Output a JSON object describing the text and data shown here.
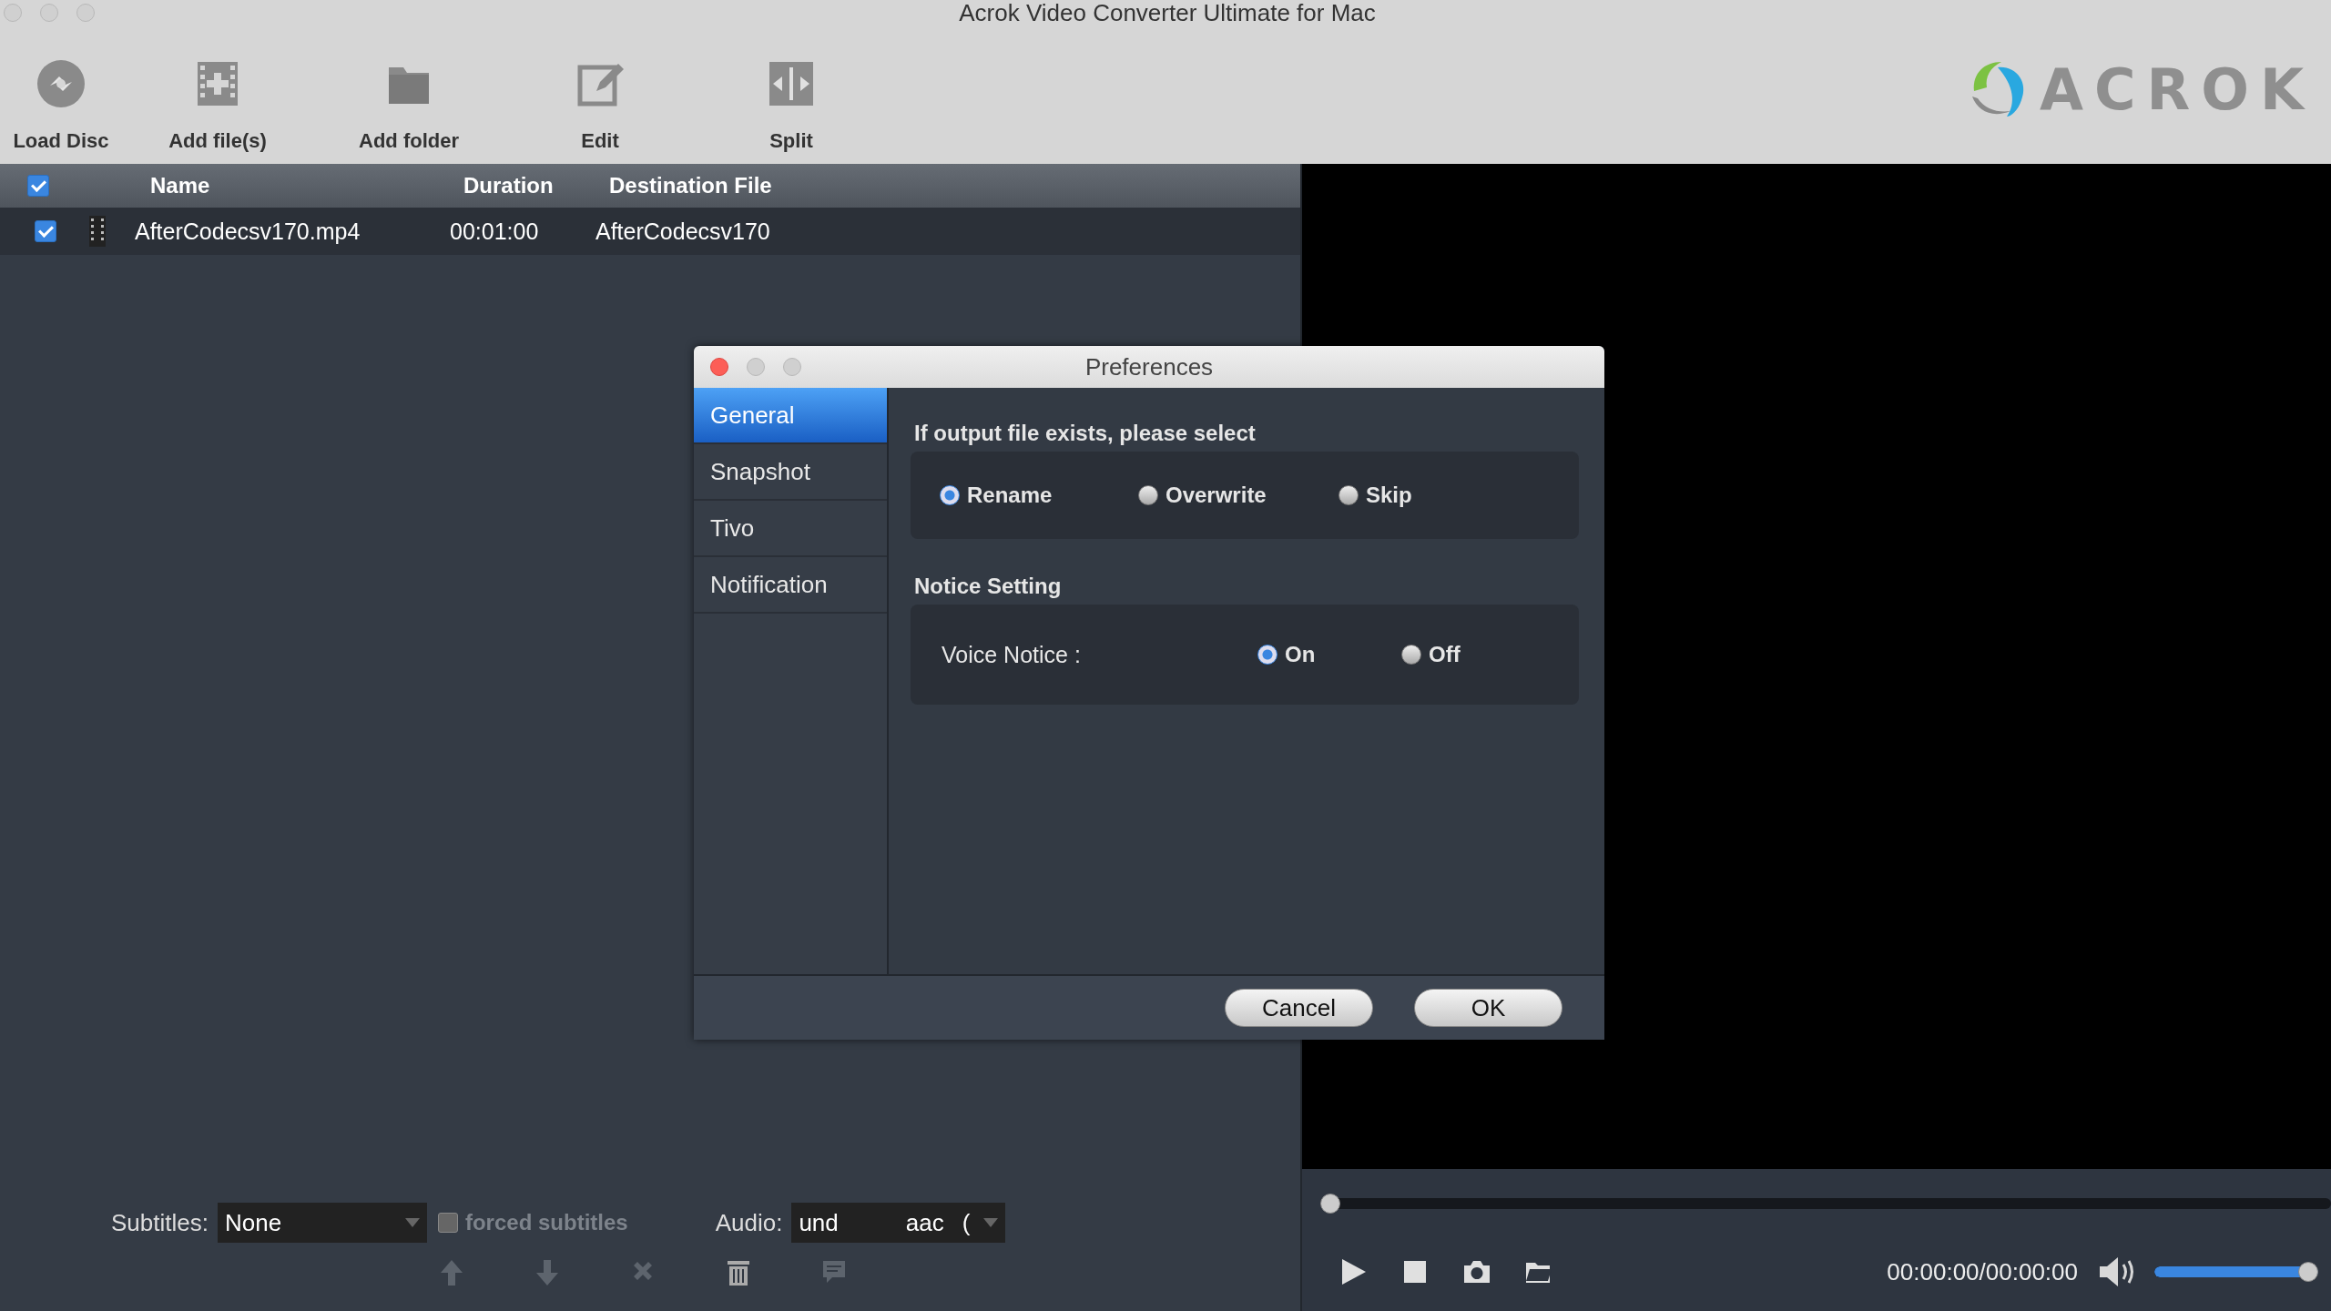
{
  "window": {
    "title": "Acrok Video Converter Ultimate for Mac"
  },
  "toolbar": [
    {
      "kind": "disc",
      "label": "Load Disc"
    },
    {
      "kind": "film",
      "label": "Add file(s)"
    },
    {
      "kind": "folder",
      "label": "Add folder"
    },
    {
      "kind": "edit",
      "label": "Edit"
    },
    {
      "kind": "split",
      "label": "Split"
    }
  ],
  "logo": {
    "text": "ACROK"
  },
  "file_list": {
    "select_all_checked": true,
    "columns": [
      "Name",
      "Duration",
      "Destination File"
    ],
    "rows": [
      {
        "checked": true,
        "name": "AfterCodecsv170.mp4",
        "duration": "00:01:00",
        "destination": "AfterCodecsv170"
      }
    ]
  },
  "subtitles": {
    "label": "Subtitles:",
    "value": "None",
    "forced": {
      "label": "forced subtitles",
      "checked": false,
      "disabled": true
    }
  },
  "audio": {
    "label": "Audio:",
    "value": "und",
    "codec": "aac",
    "extra": "("
  },
  "list_actions": [
    {
      "kind": "up",
      "disabled": true
    },
    {
      "kind": "down",
      "disabled": true
    },
    {
      "kind": "remove",
      "disabled": true
    },
    {
      "kind": "trash",
      "disabled": false
    },
    {
      "kind": "comment",
      "disabled": true
    }
  ],
  "player": {
    "seek": {
      "level": 0
    },
    "buttons": [
      {
        "kind": "play"
      },
      {
        "kind": "stop"
      },
      {
        "kind": "camera"
      },
      {
        "kind": "folder"
      }
    ],
    "time": "00:00:00/00:00:00",
    "volume": {
      "level": 1
    }
  },
  "preferences": {
    "title": "Preferences",
    "tabs": [
      {
        "label": "General",
        "selected": true
      },
      {
        "label": "Snapshot",
        "selected": false
      },
      {
        "label": "Tivo",
        "selected": false
      },
      {
        "label": "Notification",
        "selected": false
      }
    ],
    "groups": [
      {
        "title": "If output file exists, please select",
        "options": [
          {
            "label": "Rename",
            "selected": true
          },
          {
            "label": "Overwrite",
            "selected": false
          },
          {
            "label": "Skip",
            "selected": false
          }
        ]
      },
      {
        "title": "Notice Setting",
        "label": "Voice Notice :",
        "options": [
          {
            "label": "On",
            "selected": true
          },
          {
            "label": "Off",
            "selected": false
          }
        ]
      }
    ],
    "buttons": [
      "Cancel",
      "OK"
    ]
  }
}
